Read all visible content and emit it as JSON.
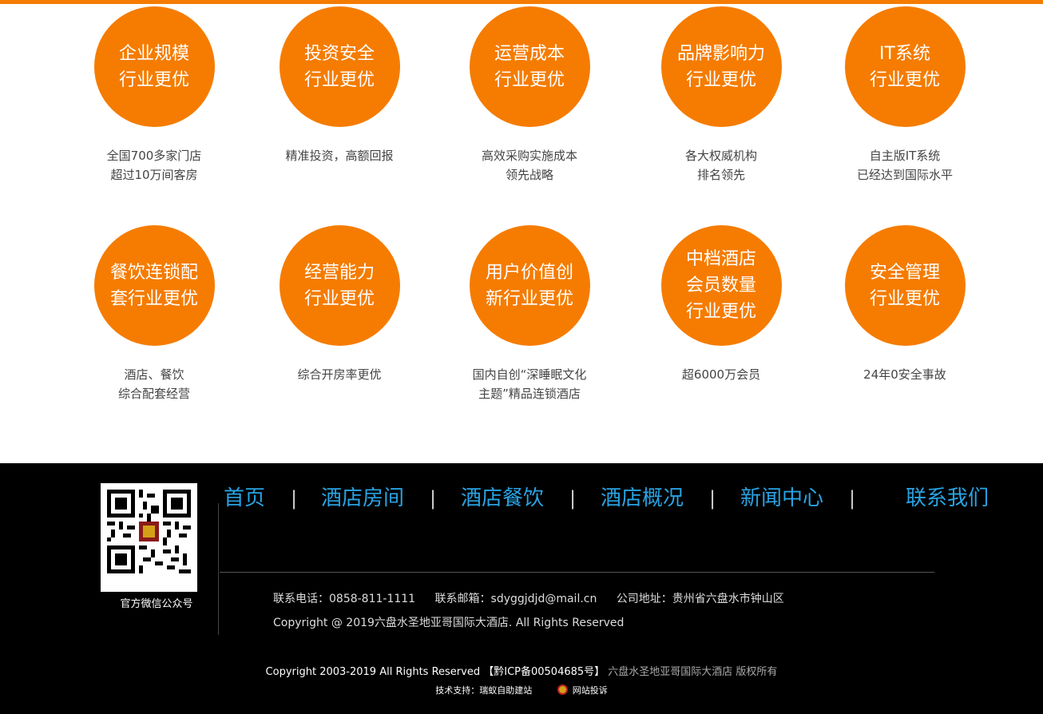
{
  "features": [
    {
      "title": "企业规模\n行业更优",
      "desc": "全国700多家门店\n超过10万间客房"
    },
    {
      "title": "投资安全\n行业更优",
      "desc": "精准投资，高额回报"
    },
    {
      "title": "运营成本\n行业更优",
      "desc": "高效采购实施成本\n领先战略"
    },
    {
      "title": "品牌影响力\n行业更优",
      "desc": "各大权威机构\n排名领先"
    },
    {
      "title": "IT系统\n行业更优",
      "desc": "自主版IT系统\n已经达到国际水平"
    },
    {
      "title": "餐饮连锁配\n套行业更优",
      "desc": "酒店、餐饮\n综合配套经营"
    },
    {
      "title": "经营能力\n行业更优",
      "desc": "综合开房率更优"
    },
    {
      "title": "用户价值创\n新行业更优",
      "desc": "国内自创“深睡眠文化\n主题”精品连锁酒店"
    },
    {
      "title": "中档酒店\n会员数量\n行业更优",
      "desc": "超6000万会员"
    },
    {
      "title": "安全管理\n行业更优",
      "desc": "24年0安全事故"
    }
  ],
  "footer": {
    "qr_caption": "官方微信公众号",
    "nav": [
      "首页",
      "酒店房间",
      "酒店餐饮",
      "酒店概况",
      "新闻中心",
      "联系我们"
    ],
    "separator": "|",
    "phone": "联系电话：0858-811-1111",
    "email": "联系邮箱：sdyggjdjd@mail.cn",
    "address": "公司地址：贵州省六盘水市钟山区",
    "copyright": "Copyright @ 2019六盘水圣地亚哥国际大酒店. All Rights Reserved",
    "site_copyright": "Copyright 2003-2019  All Rights Reserved",
    "icp": "【黔ICP备00504685号】",
    "owner": "六盘水圣地亚哥国际大酒店 版权所有",
    "tech_support": "技术支持：瑞蚁自助建站",
    "report": "网站投诉"
  },
  "colors": {
    "accent": "#f57c00",
    "nav_link": "#29a3e3",
    "footer_bg": "#000000"
  }
}
